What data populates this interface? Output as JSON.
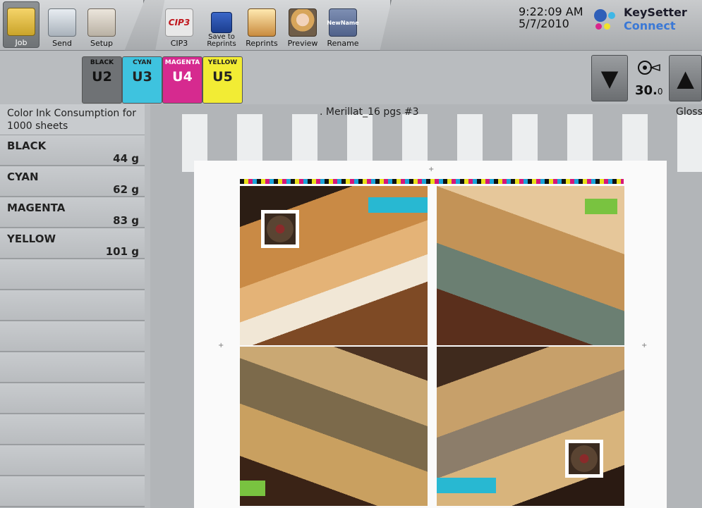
{
  "toolbar": {
    "buttons": [
      {
        "label": "Job",
        "icon": "folder-icon",
        "active": true
      },
      {
        "label": "Send",
        "icon": "send-icon"
      },
      {
        "label": "Setup",
        "icon": "setup-wrench-icon"
      },
      {
        "label": "CIP3",
        "icon": "cip3-icon",
        "icon_text": "CIP3"
      },
      {
        "label": "Save to Reprints",
        "icon": "save-disk-icon"
      },
      {
        "label": "Reprints",
        "icon": "reprints-icon"
      },
      {
        "label": "Preview",
        "icon": "preview-icon"
      },
      {
        "label": "Rename",
        "icon": "rename-icon",
        "icon_text": "NewName"
      }
    ],
    "time": "9:22:09 AM",
    "date": "5/7/2010",
    "logo_line1": "KeySetter",
    "logo_line2": "Connect"
  },
  "units": [
    {
      "name": "BLACK",
      "code": "U2",
      "color": "#6f7275",
      "text": "#111111"
    },
    {
      "name": "CYAN",
      "code": "U3",
      "color": "#3ec3df",
      "text": "#111111"
    },
    {
      "name": "MAGENTA",
      "code": "U4",
      "color": "#d62a8f",
      "text": "#ffffff"
    },
    {
      "name": "YELLOW",
      "code": "U5",
      "color": "#f2ec34",
      "text": "#111111"
    }
  ],
  "speed": {
    "value": "30.",
    "decimal": "0"
  },
  "consumption": {
    "title": "Color Ink Consumption for 1000 sheets",
    "inks": [
      {
        "name": "BLACK",
        "value": "44 g"
      },
      {
        "name": "CYAN",
        "value": "62 g"
      },
      {
        "name": "MAGENTA",
        "value": "83 g"
      },
      {
        "name": "YELLOW",
        "value": "101 g"
      }
    ]
  },
  "preview": {
    "job_title": ". Merillat_16 pgs #3",
    "gloss_label": "Gloss"
  }
}
